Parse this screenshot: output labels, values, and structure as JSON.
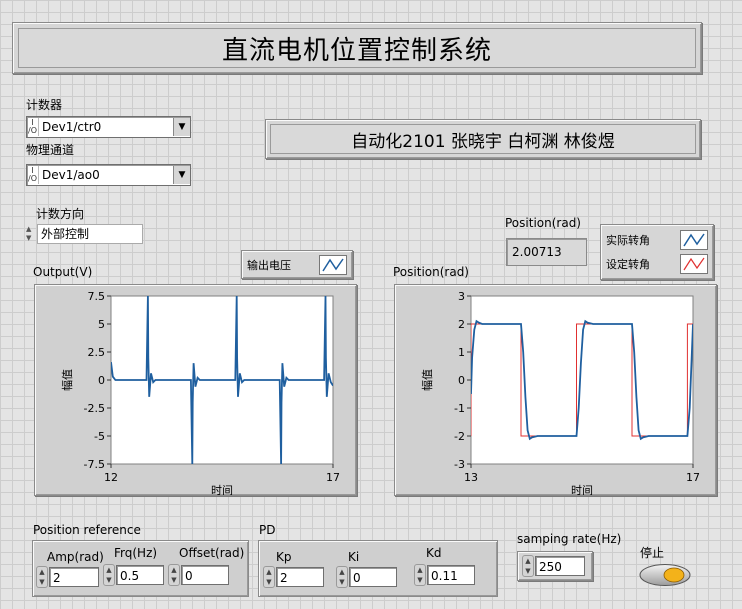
{
  "title": "直流电机位置控制系统",
  "authors": "自动化2101 张晓宇 白柯渊 林俊煜",
  "counter": {
    "label": "计数器",
    "value": "Dev1/ctr0"
  },
  "channel": {
    "label": "物理通道",
    "value": "Dev1/ao0"
  },
  "direction": {
    "label": "计数方向",
    "value": "外部控制"
  },
  "position_indicator": {
    "label": "Position(rad)",
    "value": "2.00713"
  },
  "legend_position": {
    "actual": "实际转角",
    "setpoint": "设定转角"
  },
  "legend_output": {
    "label": "输出电压"
  },
  "colors": {
    "actual": "#1f5f9f",
    "setpoint": "#e03030"
  },
  "charts": {
    "output": {
      "title": "Output(V)",
      "ylabel": "幅值",
      "xlabel": "时间"
    },
    "position": {
      "title": "Position(rad)",
      "ylabel": "幅值",
      "xlabel": "时间"
    }
  },
  "position_reference": {
    "label": "Position reference",
    "amp": {
      "label": "Amp(rad)",
      "value": "2"
    },
    "frq": {
      "label": "Frq(Hz)",
      "value": "0.5"
    },
    "offset": {
      "label": "Offset(rad)",
      "value": "0"
    }
  },
  "pd": {
    "label": "PD",
    "kp": {
      "label": "Kp",
      "value": "2"
    },
    "ki": {
      "label": "Ki",
      "value": "0"
    },
    "kd": {
      "label": "Kd",
      "value": "0.11"
    }
  },
  "sampling_rate": {
    "label": "samping rate(Hz)",
    "value": "250"
  },
  "stop": {
    "label": "停止"
  },
  "chart_data": [
    {
      "type": "line",
      "title": "Output(V)",
      "xlabel": "时间",
      "ylabel": "幅值",
      "xlim": [
        12,
        17
      ],
      "ylim": [
        -7.5,
        7.5
      ],
      "x_ticks": [
        "12",
        "17"
      ],
      "y_ticks": [
        "7.5",
        "5",
        "2.5",
        "0",
        "-2.5",
        "-5",
        "-7.5"
      ],
      "series": [
        {
          "name": "输出电压",
          "x": [
            12,
            12.04,
            12.1,
            12.3,
            12.5,
            12.8,
            12.83,
            12.84,
            12.86,
            12.9,
            12.95,
            13.0,
            13.3,
            13.5,
            13.8,
            13.83,
            13.84,
            13.86,
            13.9,
            13.95,
            14.0,
            14.3,
            14.5,
            14.8,
            14.83,
            14.84,
            14.86,
            14.9,
            14.95,
            15.0,
            15.3,
            15.5,
            15.8,
            15.83,
            15.84,
            15.86,
            15.9,
            15.95,
            16.0,
            16.3,
            16.5,
            16.8,
            16.83,
            16.84,
            16.86,
            16.9,
            16.95,
            17.0
          ],
          "values": [
            1.6,
            0.3,
            0,
            0,
            0,
            0,
            7.5,
            2.0,
            -1.5,
            0.6,
            -0.2,
            0,
            0,
            0,
            0,
            -7.5,
            -2.0,
            1.5,
            -0.6,
            0.2,
            0,
            0,
            0,
            0,
            7.5,
            2.0,
            -1.5,
            0.6,
            -0.2,
            0,
            0,
            0,
            0,
            -7.5,
            -2.0,
            1.5,
            -0.6,
            0.2,
            0,
            0,
            0,
            0,
            7.5,
            2.0,
            -1.5,
            0.6,
            -0.2,
            -0.5
          ]
        }
      ]
    },
    {
      "type": "line",
      "title": "Position(rad)",
      "xlabel": "时间",
      "ylabel": "幅值",
      "xlim": [
        13,
        17
      ],
      "ylim": [
        -3,
        3
      ],
      "x_ticks": [
        "13",
        "17"
      ],
      "y_ticks": [
        "3",
        "2",
        "1",
        "0",
        "-1",
        "-2",
        "-3"
      ],
      "series": [
        {
          "name": "实际转角",
          "x": [
            13,
            13.02,
            13.06,
            13.1,
            13.14,
            13.2,
            13.5,
            13.9,
            13.94,
            13.98,
            14.02,
            14.06,
            14.1,
            14.2,
            14.5,
            14.9,
            14.94,
            14.98,
            15.02,
            15.06,
            15.1,
            15.2,
            15.5,
            15.9,
            15.94,
            15.98,
            16.02,
            16.06,
            16.1,
            16.2,
            16.5,
            16.9,
            16.94,
            16.98,
            17.0
          ],
          "values": [
            -0.5,
            0.8,
            1.8,
            2.1,
            2.05,
            2.0,
            2.0,
            2.0,
            1.0,
            -0.6,
            -1.8,
            -2.1,
            -2.05,
            -2.0,
            -2.0,
            -2.0,
            -1.0,
            0.6,
            1.8,
            2.1,
            2.05,
            2.0,
            2.0,
            2.0,
            1.0,
            -0.6,
            -1.8,
            -2.1,
            -2.05,
            -2.0,
            -2.0,
            -2.0,
            -1.0,
            1.0,
            2.0
          ]
        },
        {
          "name": "设定转角",
          "x": [
            13,
            13.0,
            13.1,
            13.9,
            13.9,
            14.9,
            14.9,
            15.9,
            15.9,
            16.9,
            16.9,
            17.0
          ],
          "values": [
            -2,
            2,
            2,
            2,
            -2,
            -2,
            2,
            2,
            -2,
            -2,
            2,
            2
          ]
        }
      ]
    }
  ]
}
